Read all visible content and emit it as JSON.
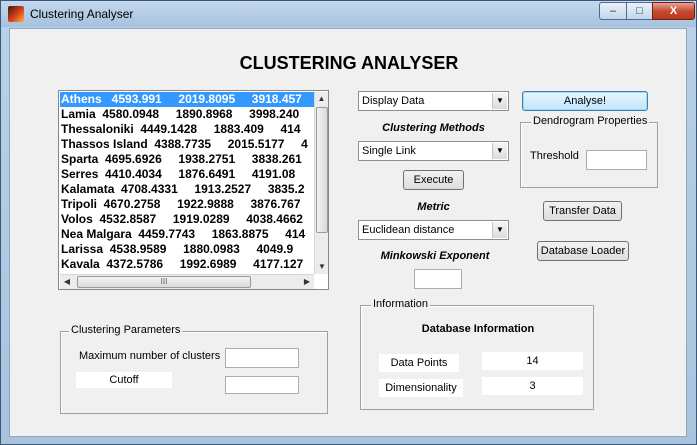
{
  "window": {
    "title": "Clustering Analyser",
    "buttons": {
      "minimize": "–",
      "maximize": "□",
      "close": "X"
    }
  },
  "heading": "CLUSTERING ANALYSER",
  "data_list": {
    "rows": [
      "Athens   4593.991     2019.8095     3918.457",
      "Lamia  4580.0948     1890.8968     3998.240",
      "Thessaloniki  4449.1428     1883.409     414",
      "Thassos Island  4388.7735     2015.5177     4",
      "Sparta  4695.6926     1938.2751     3838.261",
      "Serres  4410.4034     1876.6491     4191.08",
      "Kalamata  4708.4331     1913.2527     3835.2",
      "Tripoli  4670.2758     1922.9888     3876.767",
      "Volos  4532.8587     1919.0289     4038.4662",
      "Nea Malgara  4459.7743     1863.8875     414",
      "Larissa  4538.9589     1880.0983     4049.9",
      "Kavala  4372.5786     1992.6989     4177.127"
    ],
    "selected_index": 0,
    "scroll_grip": "III"
  },
  "display_combo": {
    "value": "Display Data"
  },
  "analyse_button": "Analyse!",
  "clustering_methods": {
    "label": "Clustering Methods",
    "value": "Single Link"
  },
  "execute_button": "Execute",
  "metric": {
    "label": "Metric",
    "value": "Euclidean distance"
  },
  "minkowski": {
    "label": "Minkowski Exponent",
    "value": ""
  },
  "dendrogram": {
    "legend": "Dendrogram Properties",
    "threshold_label": "Threshold",
    "threshold_value": ""
  },
  "transfer_button": "Transfer Data",
  "loader_button": "Database Loader",
  "clustering_params": {
    "legend": "Clustering Parameters",
    "max_clusters_label": "Maximum number of clusters",
    "max_clusters_value": "",
    "cutoff_label": "Cutoff",
    "cutoff_value": ""
  },
  "information": {
    "legend": "Information",
    "title": "Database Information",
    "data_points_label": "Data Points",
    "data_points_value": "14",
    "dimensionality_label": "Dimensionality",
    "dimensionality_value": "3"
  }
}
